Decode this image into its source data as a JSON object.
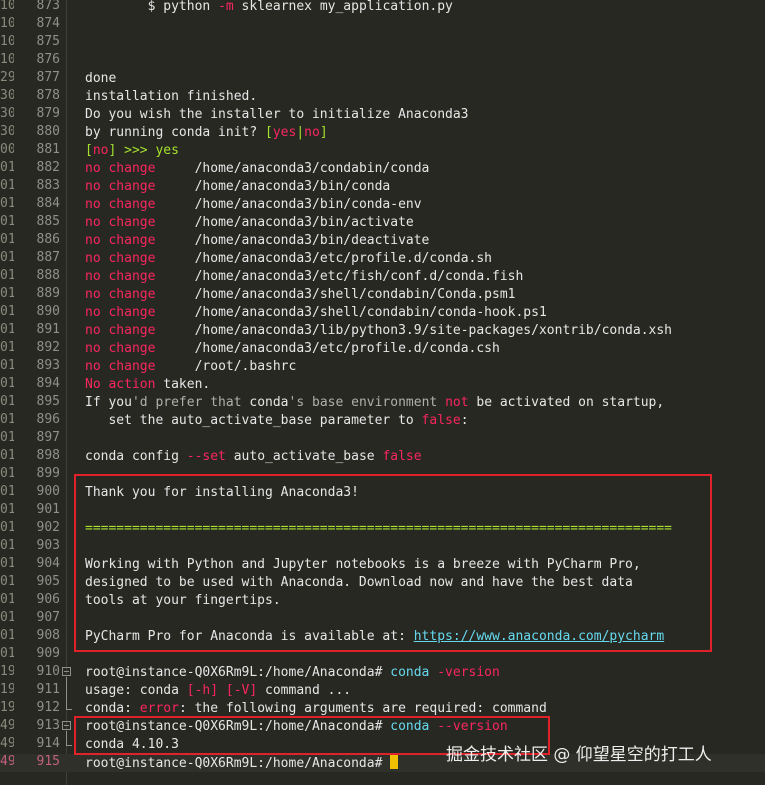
{
  "terminal": {
    "lines": [
      {
        "ts": "10]",
        "ln": "873",
        "seg": [
          {
            "t": "        ",
            "c": "c-txt"
          },
          {
            "t": "$ ",
            "c": "c-txt"
          },
          {
            "t": "python ",
            "c": "c-txt"
          },
          {
            "t": "-m",
            "c": "c-red"
          },
          {
            "t": " sklearnex my_application.py",
            "c": "c-txt"
          }
        ]
      },
      {
        "ts": "10]",
        "ln": "874",
        "seg": []
      },
      {
        "ts": "10]",
        "ln": "875",
        "seg": []
      },
      {
        "ts": "10]",
        "ln": "876",
        "seg": []
      },
      {
        "ts": "29]",
        "ln": "877",
        "seg": [
          {
            "t": "done",
            "c": "c-txt"
          }
        ]
      },
      {
        "ts": "30]",
        "ln": "878",
        "seg": [
          {
            "t": "installation finished.",
            "c": "c-txt"
          }
        ]
      },
      {
        "ts": "30]",
        "ln": "879",
        "seg": [
          {
            "t": "Do you wish the installer to initialize Anaconda3",
            "c": "c-txt"
          }
        ]
      },
      {
        "ts": "30]",
        "ln": "880",
        "seg": [
          {
            "t": "by running conda init? ",
            "c": "c-txt"
          },
          {
            "t": "[",
            "c": "c-grn"
          },
          {
            "t": "yes",
            "c": "c-red"
          },
          {
            "t": "|",
            "c": "c-grn"
          },
          {
            "t": "no",
            "c": "c-red"
          },
          {
            "t": "]",
            "c": "c-grn"
          }
        ]
      },
      {
        "ts": "00]",
        "ln": "881",
        "seg": [
          {
            "t": "[",
            "c": "c-grn"
          },
          {
            "t": "no",
            "c": "c-red"
          },
          {
            "t": "] >>> yes",
            "c": "c-grn"
          }
        ]
      },
      {
        "ts": "01]",
        "ln": "882",
        "seg": [
          {
            "t": "no change",
            "c": "c-red"
          },
          {
            "t": "     /home/anaconda3/condabin/conda",
            "c": "c-txt"
          }
        ]
      },
      {
        "ts": "01]",
        "ln": "883",
        "seg": [
          {
            "t": "no change",
            "c": "c-red"
          },
          {
            "t": "     /home/anaconda3/bin/conda",
            "c": "c-txt"
          }
        ]
      },
      {
        "ts": "01]",
        "ln": "884",
        "seg": [
          {
            "t": "no change",
            "c": "c-red"
          },
          {
            "t": "     /home/anaconda3/bin/conda-env",
            "c": "c-txt"
          }
        ]
      },
      {
        "ts": "01]",
        "ln": "885",
        "seg": [
          {
            "t": "no change",
            "c": "c-red"
          },
          {
            "t": "     /home/anaconda3/bin/activate",
            "c": "c-txt"
          }
        ]
      },
      {
        "ts": "01]",
        "ln": "886",
        "seg": [
          {
            "t": "no change",
            "c": "c-red"
          },
          {
            "t": "     /home/anaconda3/bin/deactivate",
            "c": "c-txt"
          }
        ]
      },
      {
        "ts": "01]",
        "ln": "887",
        "seg": [
          {
            "t": "no change",
            "c": "c-red"
          },
          {
            "t": "     /home/anaconda3/etc/profile.d/conda.sh",
            "c": "c-txt"
          }
        ]
      },
      {
        "ts": "01]",
        "ln": "888",
        "seg": [
          {
            "t": "no change",
            "c": "c-red"
          },
          {
            "t": "     /home/anaconda3/etc/fish/conf.d/conda.fish",
            "c": "c-txt"
          }
        ]
      },
      {
        "ts": "01]",
        "ln": "889",
        "seg": [
          {
            "t": "no change",
            "c": "c-red"
          },
          {
            "t": "     /home/anaconda3/shell/condabin/Conda.psm1",
            "c": "c-txt"
          }
        ]
      },
      {
        "ts": "01]",
        "ln": "890",
        "seg": [
          {
            "t": "no change",
            "c": "c-red"
          },
          {
            "t": "     /home/anaconda3/shell/condabin/conda-hook.ps1",
            "c": "c-txt"
          }
        ]
      },
      {
        "ts": "01]",
        "ln": "891",
        "seg": [
          {
            "t": "no change",
            "c": "c-red"
          },
          {
            "t": "     /home/anaconda3/lib/python3.9/site-packages/xontrib/conda.xsh",
            "c": "c-txt"
          }
        ]
      },
      {
        "ts": "01]",
        "ln": "892",
        "seg": [
          {
            "t": "no change",
            "c": "c-red"
          },
          {
            "t": "     /home/anaconda3/etc/profile.d/conda.csh",
            "c": "c-txt"
          }
        ]
      },
      {
        "ts": "01]",
        "ln": "893",
        "seg": [
          {
            "t": "no change",
            "c": "c-red"
          },
          {
            "t": "     /root/.bashrc",
            "c": "c-txt"
          }
        ]
      },
      {
        "ts": "01]",
        "ln": "894",
        "seg": [
          {
            "t": "No action",
            "c": "c-red"
          },
          {
            "t": " taken.",
            "c": "c-txt"
          }
        ]
      },
      {
        "ts": "01]",
        "ln": "895",
        "seg": [
          {
            "t": "If you",
            "c": "c-txt"
          },
          {
            "t": "'d prefer that ",
            "c": "c-dim"
          },
          {
            "t": "conda",
            "c": "c-txt"
          },
          {
            "t": "'s base environment ",
            "c": "c-dim"
          },
          {
            "t": "not",
            "c": "c-red"
          },
          {
            "t": " be activated on startup,",
            "c": "c-txt"
          }
        ]
      },
      {
        "ts": "01]",
        "ln": "896",
        "seg": [
          {
            "t": "   set the auto_activate_base parameter to ",
            "c": "c-txt"
          },
          {
            "t": "false",
            "c": "c-red"
          },
          {
            "t": ":",
            "c": "c-txt"
          }
        ]
      },
      {
        "ts": "01]",
        "ln": "897",
        "seg": []
      },
      {
        "ts": "01]",
        "ln": "898",
        "seg": [
          {
            "t": "conda config ",
            "c": "c-txt"
          },
          {
            "t": "--set",
            "c": "c-red"
          },
          {
            "t": " auto_activate_base ",
            "c": "c-txt"
          },
          {
            "t": "false",
            "c": "c-red"
          }
        ]
      },
      {
        "ts": "01]",
        "ln": "899",
        "seg": []
      },
      {
        "ts": "01]",
        "ln": "900",
        "seg": [
          {
            "t": "Thank you for installing Anaconda3!",
            "c": "c-txt"
          }
        ]
      },
      {
        "ts": "01]",
        "ln": "901",
        "seg": []
      },
      {
        "ts": "01]",
        "ln": "902",
        "seg": [
          {
            "t": "===========================================================================",
            "c": "c-grn"
          }
        ]
      },
      {
        "ts": "01]",
        "ln": "903",
        "seg": []
      },
      {
        "ts": "01]",
        "ln": "904",
        "seg": [
          {
            "t": "Working with Python and Jupyter notebooks is a breeze with PyCharm Pro,",
            "c": "c-txt"
          }
        ]
      },
      {
        "ts": "01]",
        "ln": "905",
        "seg": [
          {
            "t": "designed to be used with Anaconda. Download now and have the best data",
            "c": "c-txt"
          }
        ]
      },
      {
        "ts": "01]",
        "ln": "906",
        "seg": [
          {
            "t": "tools at your fingertips.",
            "c": "c-txt"
          }
        ]
      },
      {
        "ts": "01]",
        "ln": "907",
        "seg": []
      },
      {
        "ts": "01]",
        "ln": "908",
        "seg": [
          {
            "t": "PyCharm Pro for Anaconda is available at: ",
            "c": "c-txt"
          },
          {
            "t": "https://www.anaconda.com/pycharm",
            "c": "c-link"
          }
        ]
      },
      {
        "ts": "01]",
        "ln": "909",
        "seg": []
      },
      {
        "ts": "19]",
        "ln": "910",
        "seg": [
          {
            "t": "root@instance-Q0X6Rm9L:/home/Anaconda# ",
            "c": "c-txt"
          },
          {
            "t": "conda ",
            "c": "c-blue"
          },
          {
            "t": "-version",
            "c": "c-red"
          }
        ]
      },
      {
        "ts": "19]",
        "ln": "911",
        "seg": [
          {
            "t": "usage: conda ",
            "c": "c-txt"
          },
          {
            "t": "[-h]",
            "c": "c-red"
          },
          {
            "t": " ",
            "c": "c-txt"
          },
          {
            "t": "[-V]",
            "c": "c-red"
          },
          {
            "t": " command ...",
            "c": "c-txt"
          }
        ]
      },
      {
        "ts": "19]",
        "ln": "912",
        "seg": [
          {
            "t": "conda: ",
            "c": "c-txt"
          },
          {
            "t": "error",
            "c": "c-red"
          },
          {
            "t": ": the following arguments are required: command",
            "c": "c-txt"
          }
        ]
      },
      {
        "ts": "49]",
        "ln": "913",
        "seg": [
          {
            "t": "root@instance-Q0X6Rm9L:/home/Anaconda# ",
            "c": "c-txt"
          },
          {
            "t": "conda ",
            "c": "c-blue"
          },
          {
            "t": "--version",
            "c": "c-red"
          }
        ]
      },
      {
        "ts": "49]",
        "ln": "914",
        "seg": [
          {
            "t": "conda 4.10.3",
            "c": "c-txt"
          }
        ]
      },
      {
        "ts": "49]",
        "ln": "915",
        "seg": [
          {
            "t": "root@instance-Q0X6Rm9L:/home/Anaconda# ",
            "c": "c-txt"
          }
        ]
      }
    ]
  },
  "watermark": "掘金技术社区 @ 仰望星空的打工人",
  "colors": {
    "background": "#272822",
    "highlight_box": "#e0232b",
    "cursor": "#f0c000"
  }
}
